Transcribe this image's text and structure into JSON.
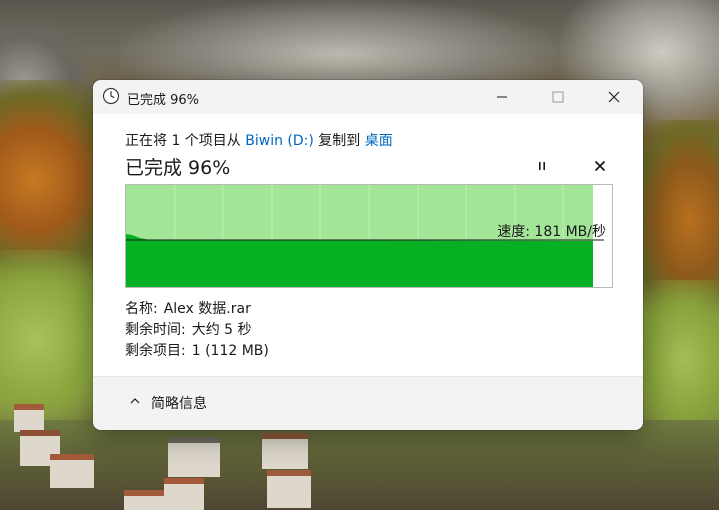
{
  "window": {
    "title": "已完成 96%",
    "icon": "clock-icon"
  },
  "copy": {
    "prefix": "正在将 1 个项目从",
    "source": "Biwin (D:)",
    "middle": "复制到",
    "destination": "桌面"
  },
  "progress": {
    "heading": "已完成 96%",
    "percent": 96,
    "speed": "速度: 181 MB/秒"
  },
  "details": {
    "name_label": "名称:",
    "name_value": "Alex 数据.rar",
    "time_label": "剩余时间:",
    "time_value": "大约 5 秒",
    "items_label": "剩余项目:",
    "items_value": "1 (112 MB)"
  },
  "footer": {
    "toggle_label": "简略信息"
  },
  "colors": {
    "link": "#0067c0",
    "graph_done_light": "#a3e698",
    "graph_speed_fill": "#06b022",
    "graph_border": "#b9b9b9",
    "dialog_bg": "#ffffff",
    "titlebar_bg": "#f3f3f3"
  }
}
